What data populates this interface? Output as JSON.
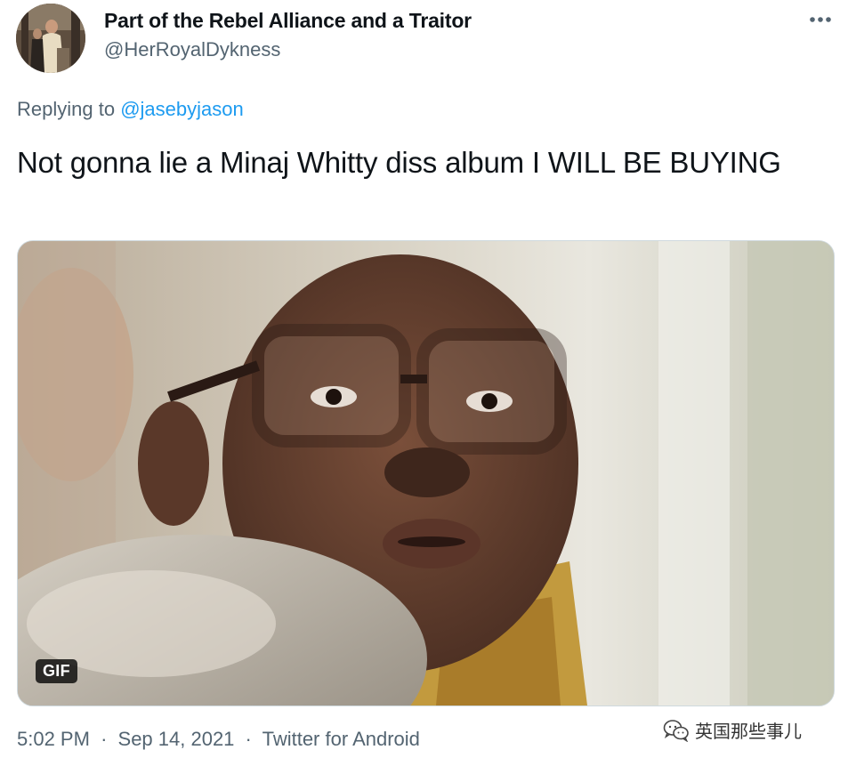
{
  "author": {
    "display_name": "Part of the Rebel Alliance and a Traitor",
    "handle": "@HerRoyalDykness",
    "avatar_icon": "profile-photo"
  },
  "more_icon": "more-horizontal-icon",
  "reply": {
    "prefix": "Replying to",
    "mention": "@jasebyjason"
  },
  "tweet": {
    "text": "Not gonna lie a Minaj Whitty diss album I WILL BE BUYING"
  },
  "media": {
    "type": "gif",
    "badge_label": "GIF"
  },
  "meta": {
    "time": "5:02 PM",
    "separator": "·",
    "date": "Sep 14, 2021",
    "source": "Twitter for Android"
  },
  "watermark": {
    "icon": "wechat-icon",
    "text": "英国那些事儿"
  },
  "colors": {
    "text_primary": "#0f1419",
    "text_secondary": "#536471",
    "link": "#1d9bf0",
    "border": "#cfd9de"
  }
}
